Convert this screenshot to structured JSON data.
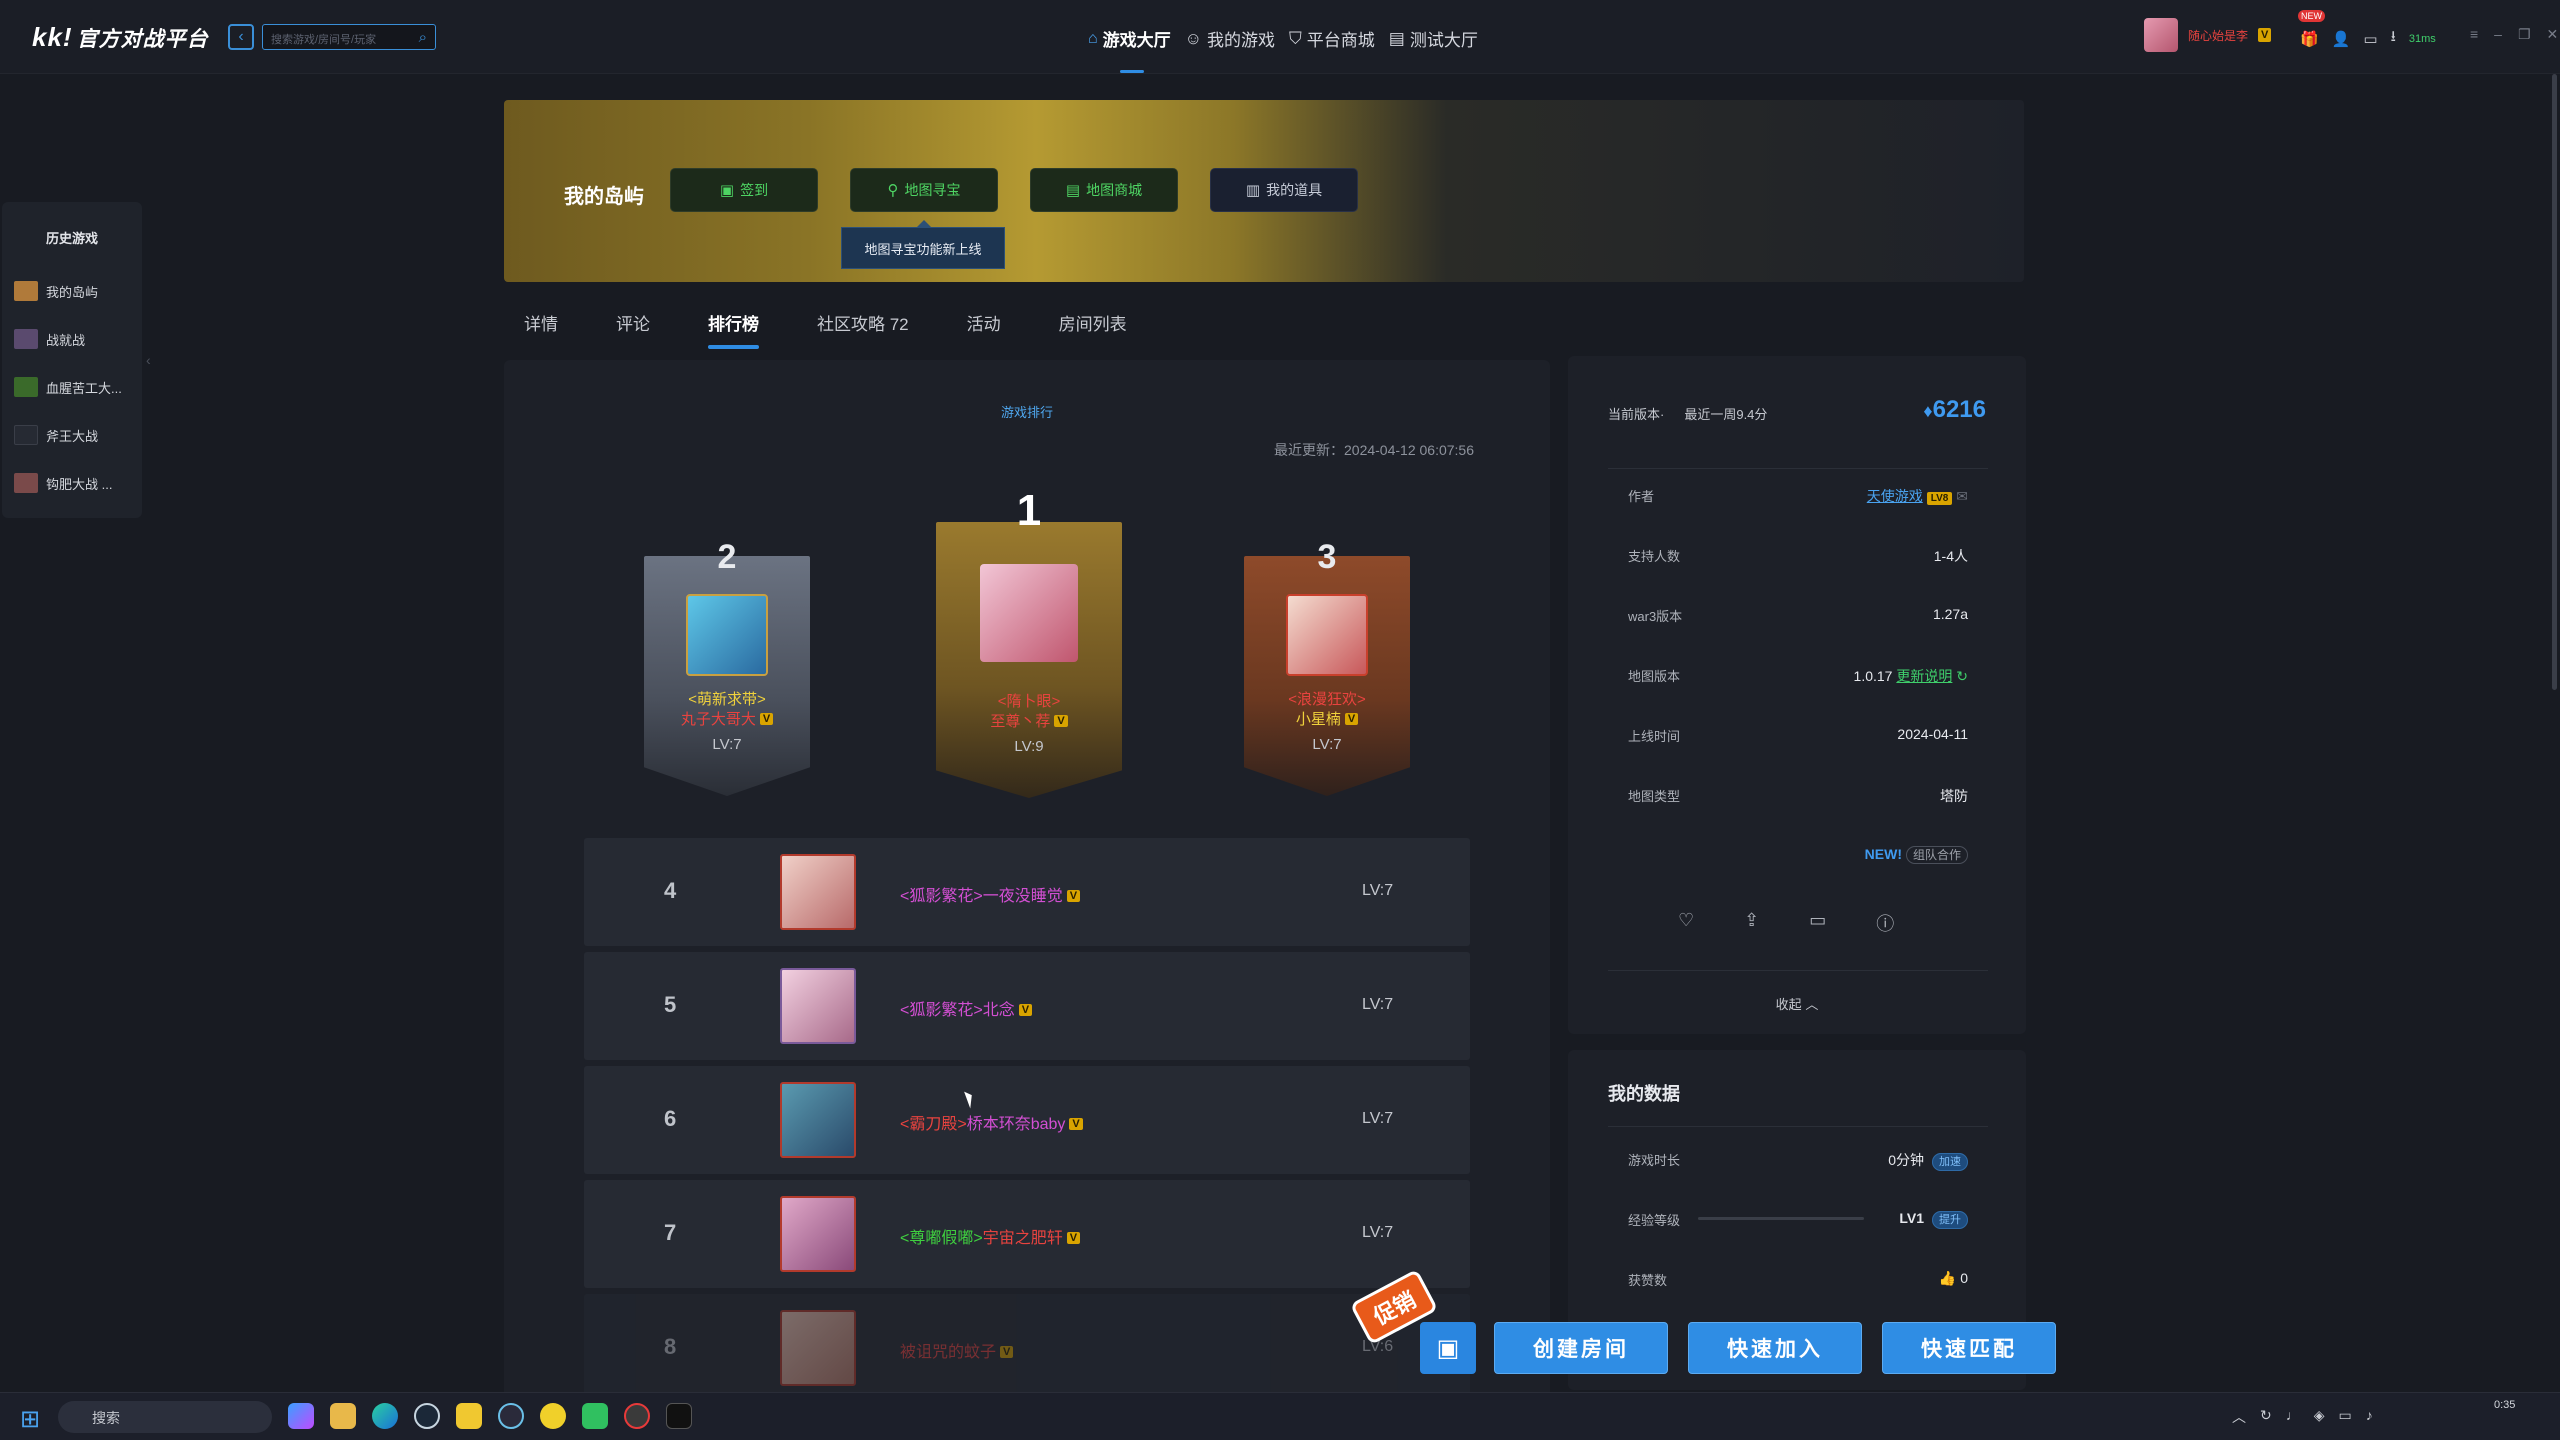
{
  "app": {
    "logo_mark": "kk!",
    "logo_text": "官方对战平台",
    "search_placeholder": "搜索游戏/房间号/玩家"
  },
  "nav": [
    {
      "label": "游戏大厅",
      "icon": "home-icon",
      "active": true
    },
    {
      "label": "我的游戏",
      "icon": "gamepad-icon",
      "active": false
    },
    {
      "label": "平台商城",
      "icon": "cart-icon",
      "active": false
    },
    {
      "label": "测试大厅",
      "icon": "test-icon",
      "active": false
    }
  ],
  "user": {
    "name": "随心始是李",
    "vip": "V",
    "new_tag": "NEW",
    "ping": "31ms"
  },
  "history": {
    "title": "历史游戏",
    "items": [
      {
        "label": "我的岛屿",
        "color": "#b07a3a"
      },
      {
        "label": "战就战",
        "color": "#5a4a6e"
      },
      {
        "label": "血腥苦工大...",
        "color": "#3a6a2a"
      },
      {
        "label": "斧王大战",
        "color": "#262a33"
      },
      {
        "label": "钩肥大战 ...",
        "color": "#7a4a4a"
      }
    ]
  },
  "banner": {
    "title": "我的岛屿",
    "buttons": [
      {
        "label": "签到",
        "icon": "calendar-icon"
      },
      {
        "label": "地图寻宝",
        "icon": "treasure-icon"
      },
      {
        "label": "地图商城",
        "icon": "shop-icon"
      },
      {
        "label": "我的道具",
        "icon": "bag-icon"
      }
    ],
    "tooltip": "地图寻宝功能新上线"
  },
  "tabs": [
    {
      "label": "详情",
      "active": false
    },
    {
      "label": "评论",
      "active": false
    },
    {
      "label": "排行榜",
      "active": true
    },
    {
      "label": "社区攻略 72",
      "active": false
    },
    {
      "label": "活动",
      "active": false
    },
    {
      "label": "房间列表",
      "active": false
    }
  ],
  "ranking": {
    "heading": "游戏排行",
    "last_update": "最近更新：2024-04-12 06:07:56",
    "top3": [
      {
        "rank": "2",
        "tag": "<萌新求带>",
        "name": "丸子大哥大",
        "vip": "V",
        "lv": "LV:7",
        "tag_color": "#f0d23c",
        "name_color": "#e8433f"
      },
      {
        "rank": "1",
        "tag": "<隋卜眼>",
        "name": "至尊丶荐",
        "vip": "V",
        "lv": "LV:9",
        "tag_color": "#e8433f",
        "name_color": "#e8433f"
      },
      {
        "rank": "3",
        "tag": "<浪漫狂欢>",
        "name": "小星楠",
        "vip": "V",
        "lv": "LV:7",
        "tag_color": "#e8433f",
        "name_color": "#f0d23c"
      }
    ],
    "rows": [
      {
        "rank": "4",
        "tag": "<狐影繁花>",
        "name": "一夜没睡觉",
        "vip": "V",
        "lv": "LV:7",
        "tag_color": "#d24fd2",
        "name_color": "#d24fd2"
      },
      {
        "rank": "5",
        "tag": "<狐影繁花>",
        "name": "北念",
        "vip": "V",
        "lv": "LV:7",
        "tag_color": "#d24fd2",
        "name_color": "#d24fd2"
      },
      {
        "rank": "6",
        "tag": "<霸刀殿>",
        "name": "桥本环奈baby",
        "vip": "V",
        "lv": "LV:7",
        "tag_color": "#e8433f",
        "name_color": "#d24fd2"
      },
      {
        "rank": "7",
        "tag": "<尊嘟假嘟>",
        "name": "宇宙之肥轩",
        "vip": "V",
        "lv": "LV:7",
        "tag_color": "#3fcf3f",
        "name_color": "#e8433f"
      },
      {
        "rank": "8",
        "tag": "",
        "name": "被诅咒的蚊子",
        "vip": "V",
        "lv": "LV:6",
        "tag_color": "#e8433f",
        "name_color": "#e8433f"
      }
    ]
  },
  "info": {
    "version_label": "当前版本·",
    "score_label": "最近一周9.4分",
    "hot": "6216",
    "rows": [
      {
        "label": "作者",
        "value": "天使游戏",
        "extra": "LV8"
      },
      {
        "label": "支持人数",
        "value": "1-4人"
      },
      {
        "label": "war3版本",
        "value": "1.27a"
      },
      {
        "label": "地图版本",
        "value": "1.0.17",
        "link": "更新说明"
      },
      {
        "label": "上线时间",
        "value": "2024-04-11"
      },
      {
        "label": "地图类型",
        "value": "塔防"
      }
    ],
    "new_label": "NEW!",
    "team_chip": "组队合作",
    "collapse": "收起"
  },
  "mydata": {
    "title": "我的数据",
    "rows": [
      {
        "label": "游戏时长",
        "value": "0分钟",
        "chip": "加速"
      },
      {
        "label": "经验等级",
        "value": "LV1",
        "chip": "提升"
      },
      {
        "label": "获赞数",
        "value": "0"
      }
    ]
  },
  "actions": {
    "promo": "促销",
    "create": "创建房间",
    "join": "快速加入",
    "match": "快速匹配"
  },
  "taskbar": {
    "search": "搜索",
    "time": "0:35"
  }
}
